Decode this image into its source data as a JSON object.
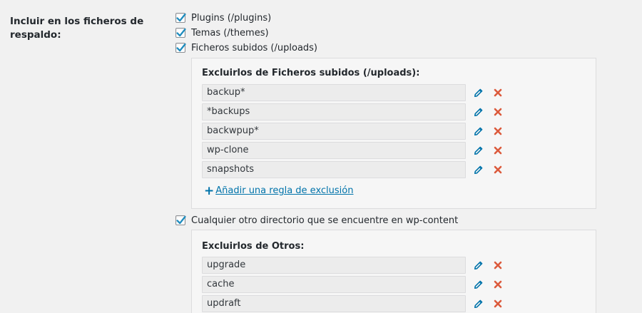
{
  "section": {
    "label": "Incluir en los ficheros de respaldo:"
  },
  "include_options": [
    {
      "label": "Plugins (/plugins)",
      "checked": true
    },
    {
      "label": "Temas (/themes)",
      "checked": true
    },
    {
      "label": "Ficheros subidos (/uploads)",
      "checked": true
    }
  ],
  "uploads_exclusions": {
    "heading": "Excluirlos de Ficheros subidos (/uploads):",
    "rules": [
      "backup*",
      "*backups",
      "backwpup*",
      "wp-clone",
      "snapshots"
    ],
    "add_rule_label": "Añadir una regla de exclusión"
  },
  "other_option": {
    "label": "Cualquier otro directorio que se encuentre en wp-content",
    "checked": true
  },
  "other_exclusions": {
    "heading": "Excluirlos de Otros:",
    "rules": [
      "upgrade",
      "cache",
      "updraft"
    ]
  },
  "icons": {
    "edit": "pencil-icon",
    "delete": "close-icon",
    "add": "plus-icon",
    "check": "checkmark-icon"
  },
  "colors": {
    "link": "#0073aa",
    "edit_icon": "#0073aa",
    "delete_icon": "#dc5a3c",
    "checkmark": "#1e8cbe"
  }
}
